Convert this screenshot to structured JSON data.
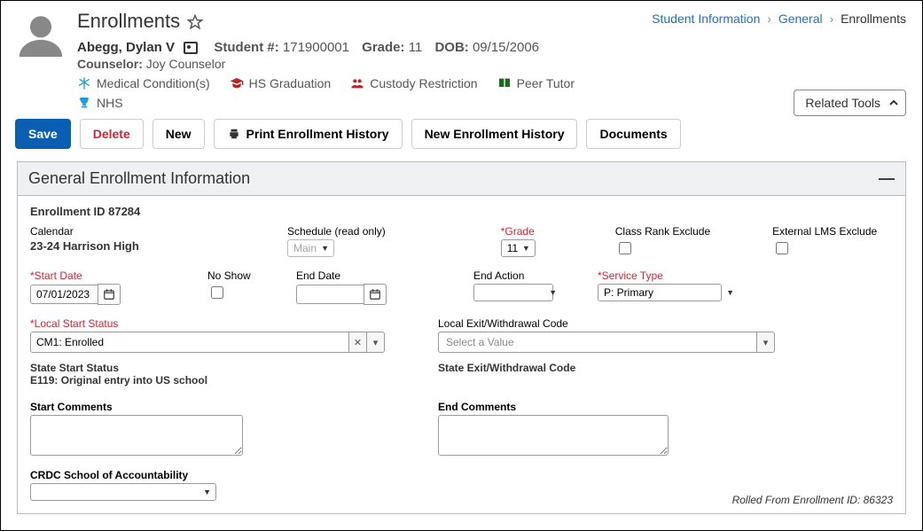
{
  "breadcrumb": {
    "a": "Student Information",
    "b": "General",
    "c": "Enrollments"
  },
  "page": {
    "title": "Enrollments"
  },
  "student": {
    "name": "Abegg, Dylan V",
    "number_label": "Student #:",
    "number": "171900001",
    "grade_label": "Grade:",
    "grade": "11",
    "dob_label": "DOB:",
    "dob": "09/15/2006",
    "counselor_label": "Counselor:",
    "counselor": "Joy Counselor"
  },
  "flags": {
    "medical": "Medical Condition(s)",
    "hs_grad": "HS Graduation",
    "custody": "Custody Restriction",
    "peer_tutor": "Peer Tutor",
    "nhs": "NHS"
  },
  "related_tools": {
    "label": "Related Tools"
  },
  "actions": {
    "save": "Save",
    "delete": "Delete",
    "new": "New",
    "print": "Print Enrollment History",
    "new_hist": "New Enrollment History",
    "documents": "Documents"
  },
  "panel": {
    "title": "General Enrollment Information",
    "enroll_id_label": "Enrollment ID 87284",
    "calendar_label": "Calendar",
    "calendar_value": "23-24 Harrison High",
    "schedule_label": "Schedule (read only)",
    "schedule_value": "Main",
    "grade_label": "Grade",
    "grade_value": "11",
    "class_rank_label": "Class Rank Exclude",
    "lms_label": "External LMS Exclude",
    "start_date_label": "Start Date",
    "start_date": "07/01/2023",
    "noshow_label": "No Show",
    "end_date_label": "End Date",
    "end_date": "",
    "end_action_label": "End Action",
    "end_action": "",
    "service_type_label": "Service Type",
    "service_type": "P: Primary",
    "local_start_label": "Local Start Status",
    "local_start": "CM1: Enrolled",
    "local_exit_label": "Local Exit/Withdrawal Code",
    "local_exit_placeholder": "Select a Value",
    "state_start_label": "State Start Status",
    "state_start_value": "E119: Original entry into US school",
    "state_exit_label": "State Exit/Withdrawal Code",
    "start_comments_label": "Start Comments",
    "end_comments_label": "End Comments",
    "crdc_label": "CRDC School of Accountability",
    "rolled": "Rolled From Enrollment ID: 86323"
  }
}
